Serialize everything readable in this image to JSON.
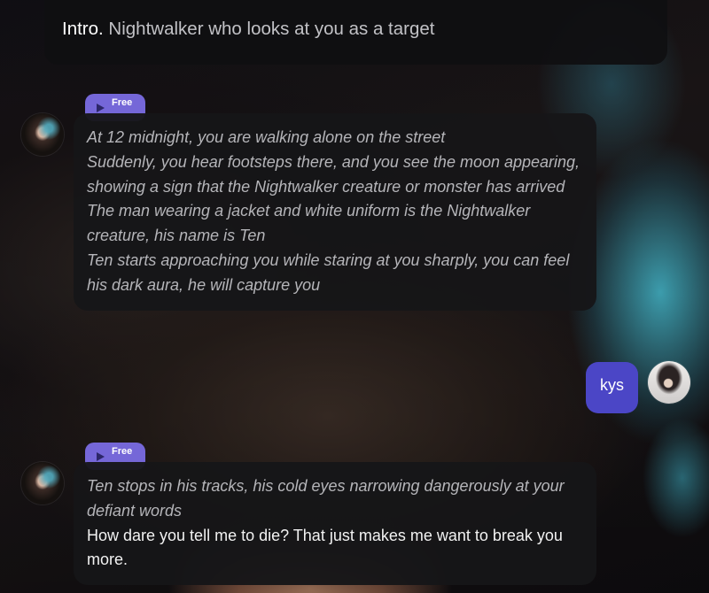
{
  "intro": {
    "label": "Intro.",
    "text": "Nightwalker who looks at you as a target"
  },
  "messages": [
    {
      "role": "bot",
      "badge": "Free",
      "lines": [
        {
          "type": "action",
          "text": "At 12 midnight, you are walking alone on the street"
        },
        {
          "type": "action",
          "text": "Suddenly, you hear footsteps there, and you see the moon appearing, showing a sign that the Nightwalker creature or monster has arrived"
        },
        {
          "type": "action",
          "text": "The man wearing a jacket and white uniform is the Nightwalker creature, his name is Ten"
        },
        {
          "type": "action",
          "text": "Ten starts approaching you while staring at you sharply, you can feel his dark aura, he will capture you"
        }
      ]
    },
    {
      "role": "user",
      "text": "kys"
    },
    {
      "role": "bot",
      "badge": "Free",
      "lines": [
        {
          "type": "action",
          "text": "Ten stops in his tracks, his cold eyes narrowing dangerously at your defiant words"
        },
        {
          "type": "speech",
          "text": "How dare you tell me to die? That just makes me want to break you more."
        }
      ]
    }
  ],
  "icons": {
    "play": "play-icon",
    "bot_avatar": "character-avatar",
    "user_avatar": "user-avatar"
  },
  "colors": {
    "user_bubble": "#4b46c6",
    "badge": "#7567d8",
    "bubble_bg": "#161618"
  }
}
